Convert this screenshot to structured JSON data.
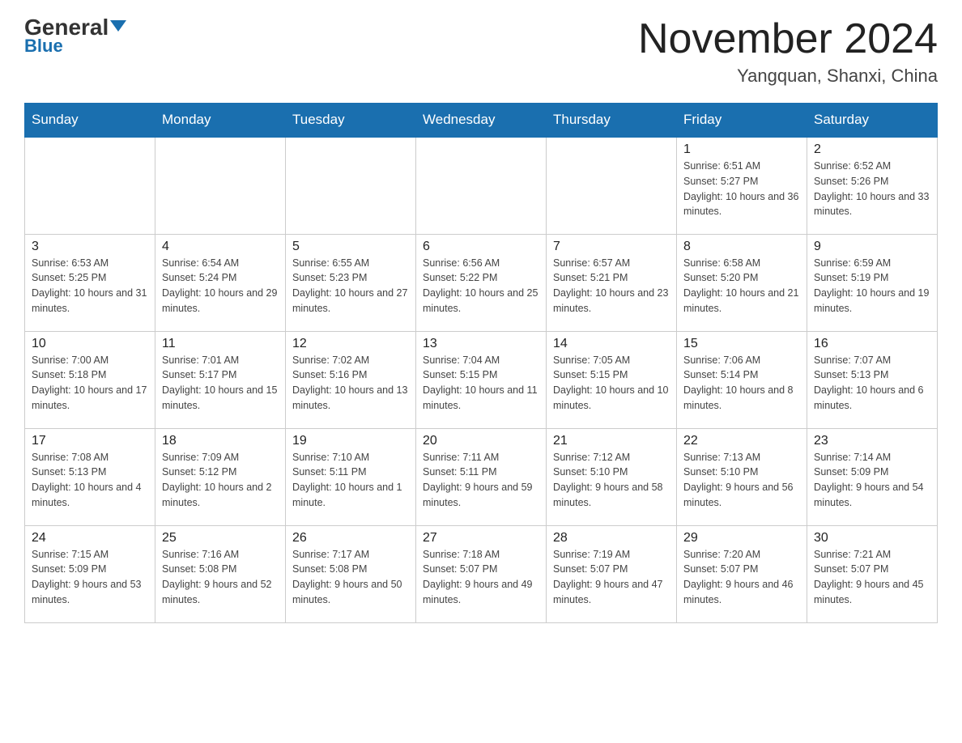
{
  "logo": {
    "general": "General",
    "blue": "Blue"
  },
  "title": {
    "month_year": "November 2024",
    "location": "Yangquan, Shanxi, China"
  },
  "weekdays": [
    "Sunday",
    "Monday",
    "Tuesday",
    "Wednesday",
    "Thursday",
    "Friday",
    "Saturday"
  ],
  "weeks": [
    [
      {
        "day": "",
        "info": ""
      },
      {
        "day": "",
        "info": ""
      },
      {
        "day": "",
        "info": ""
      },
      {
        "day": "",
        "info": ""
      },
      {
        "day": "",
        "info": ""
      },
      {
        "day": "1",
        "info": "Sunrise: 6:51 AM\nSunset: 5:27 PM\nDaylight: 10 hours and 36 minutes."
      },
      {
        "day": "2",
        "info": "Sunrise: 6:52 AM\nSunset: 5:26 PM\nDaylight: 10 hours and 33 minutes."
      }
    ],
    [
      {
        "day": "3",
        "info": "Sunrise: 6:53 AM\nSunset: 5:25 PM\nDaylight: 10 hours and 31 minutes."
      },
      {
        "day": "4",
        "info": "Sunrise: 6:54 AM\nSunset: 5:24 PM\nDaylight: 10 hours and 29 minutes."
      },
      {
        "day": "5",
        "info": "Sunrise: 6:55 AM\nSunset: 5:23 PM\nDaylight: 10 hours and 27 minutes."
      },
      {
        "day": "6",
        "info": "Sunrise: 6:56 AM\nSunset: 5:22 PM\nDaylight: 10 hours and 25 minutes."
      },
      {
        "day": "7",
        "info": "Sunrise: 6:57 AM\nSunset: 5:21 PM\nDaylight: 10 hours and 23 minutes."
      },
      {
        "day": "8",
        "info": "Sunrise: 6:58 AM\nSunset: 5:20 PM\nDaylight: 10 hours and 21 minutes."
      },
      {
        "day": "9",
        "info": "Sunrise: 6:59 AM\nSunset: 5:19 PM\nDaylight: 10 hours and 19 minutes."
      }
    ],
    [
      {
        "day": "10",
        "info": "Sunrise: 7:00 AM\nSunset: 5:18 PM\nDaylight: 10 hours and 17 minutes."
      },
      {
        "day": "11",
        "info": "Sunrise: 7:01 AM\nSunset: 5:17 PM\nDaylight: 10 hours and 15 minutes."
      },
      {
        "day": "12",
        "info": "Sunrise: 7:02 AM\nSunset: 5:16 PM\nDaylight: 10 hours and 13 minutes."
      },
      {
        "day": "13",
        "info": "Sunrise: 7:04 AM\nSunset: 5:15 PM\nDaylight: 10 hours and 11 minutes."
      },
      {
        "day": "14",
        "info": "Sunrise: 7:05 AM\nSunset: 5:15 PM\nDaylight: 10 hours and 10 minutes."
      },
      {
        "day": "15",
        "info": "Sunrise: 7:06 AM\nSunset: 5:14 PM\nDaylight: 10 hours and 8 minutes."
      },
      {
        "day": "16",
        "info": "Sunrise: 7:07 AM\nSunset: 5:13 PM\nDaylight: 10 hours and 6 minutes."
      }
    ],
    [
      {
        "day": "17",
        "info": "Sunrise: 7:08 AM\nSunset: 5:13 PM\nDaylight: 10 hours and 4 minutes."
      },
      {
        "day": "18",
        "info": "Sunrise: 7:09 AM\nSunset: 5:12 PM\nDaylight: 10 hours and 2 minutes."
      },
      {
        "day": "19",
        "info": "Sunrise: 7:10 AM\nSunset: 5:11 PM\nDaylight: 10 hours and 1 minute."
      },
      {
        "day": "20",
        "info": "Sunrise: 7:11 AM\nSunset: 5:11 PM\nDaylight: 9 hours and 59 minutes."
      },
      {
        "day": "21",
        "info": "Sunrise: 7:12 AM\nSunset: 5:10 PM\nDaylight: 9 hours and 58 minutes."
      },
      {
        "day": "22",
        "info": "Sunrise: 7:13 AM\nSunset: 5:10 PM\nDaylight: 9 hours and 56 minutes."
      },
      {
        "day": "23",
        "info": "Sunrise: 7:14 AM\nSunset: 5:09 PM\nDaylight: 9 hours and 54 minutes."
      }
    ],
    [
      {
        "day": "24",
        "info": "Sunrise: 7:15 AM\nSunset: 5:09 PM\nDaylight: 9 hours and 53 minutes."
      },
      {
        "day": "25",
        "info": "Sunrise: 7:16 AM\nSunset: 5:08 PM\nDaylight: 9 hours and 52 minutes."
      },
      {
        "day": "26",
        "info": "Sunrise: 7:17 AM\nSunset: 5:08 PM\nDaylight: 9 hours and 50 minutes."
      },
      {
        "day": "27",
        "info": "Sunrise: 7:18 AM\nSunset: 5:07 PM\nDaylight: 9 hours and 49 minutes."
      },
      {
        "day": "28",
        "info": "Sunrise: 7:19 AM\nSunset: 5:07 PM\nDaylight: 9 hours and 47 minutes."
      },
      {
        "day": "29",
        "info": "Sunrise: 7:20 AM\nSunset: 5:07 PM\nDaylight: 9 hours and 46 minutes."
      },
      {
        "day": "30",
        "info": "Sunrise: 7:21 AM\nSunset: 5:07 PM\nDaylight: 9 hours and 45 minutes."
      }
    ]
  ]
}
